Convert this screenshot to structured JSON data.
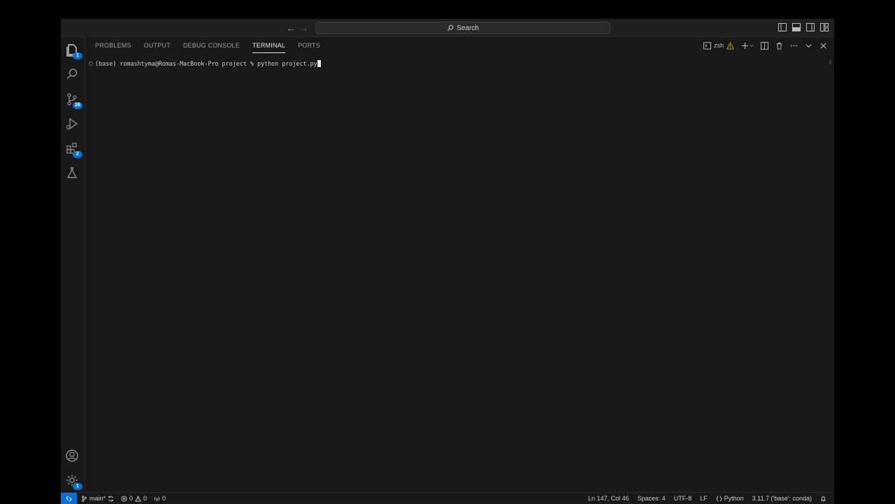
{
  "titlebar": {
    "search_label": "Search"
  },
  "activity_bar": {
    "explorer_badge": "1",
    "source_control_badge": "26",
    "extensions_badge": "2",
    "settings_badge": "1"
  },
  "panel": {
    "tabs": [
      {
        "label": "PROBLEMS"
      },
      {
        "label": "OUTPUT"
      },
      {
        "label": "DEBUG CONSOLE"
      },
      {
        "label": "TERMINAL"
      },
      {
        "label": "PORTS"
      }
    ],
    "active_tab": "TERMINAL",
    "shell_name": "zsh"
  },
  "terminal": {
    "line": "(base) romashtyma@Romas-MacBook-Pro project % python project.py"
  },
  "statusbar": {
    "branch": "main*",
    "errors": "0",
    "warnings": "0",
    "ports": "0",
    "cursor_position": "Ln 147, Col 46",
    "indentation": "Spaces: 4",
    "encoding": "UTF-8",
    "eol": "LF",
    "language": "Python",
    "interpreter": "3.11.7 ('base': conda)"
  },
  "colors": {
    "accent": "#0a6fd1",
    "background": "#181818",
    "warning": "#cca700"
  }
}
